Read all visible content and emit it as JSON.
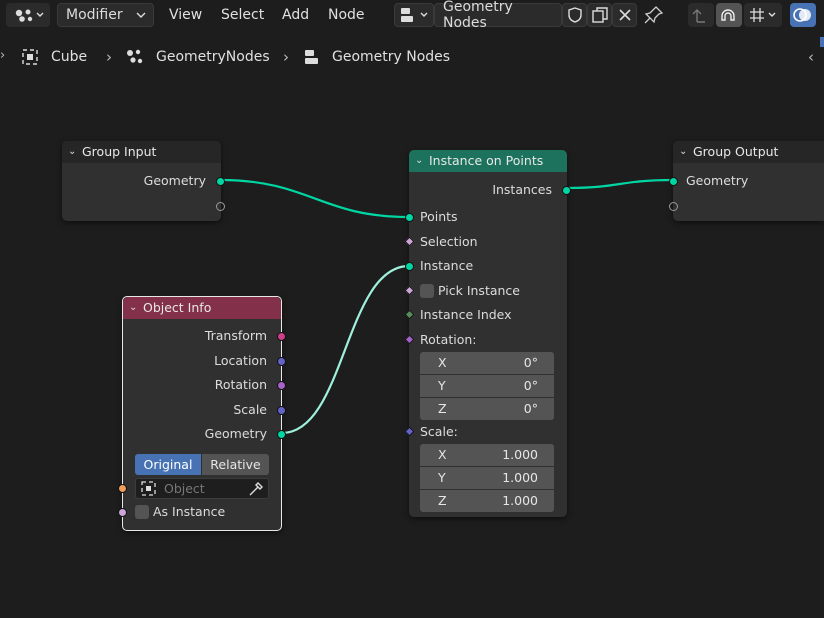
{
  "header": {
    "editor_type_icon": "node-editor-icon",
    "mode_label": "Modifier",
    "menus": [
      "View",
      "Select",
      "Add",
      "Node"
    ],
    "node_tree_name": "Geometry Nodes"
  },
  "breadcrumb": [
    "Cube",
    "GeometryNodes",
    "Geometry Nodes"
  ],
  "nodes": {
    "group_input": {
      "title": "Group Input",
      "outputs": [
        "Geometry"
      ]
    },
    "group_output": {
      "title": "Group Output",
      "inputs": [
        "Geometry"
      ]
    },
    "instance_on_points": {
      "title": "Instance on Points",
      "output": "Instances",
      "inputs": [
        "Points",
        "Selection",
        "Instance",
        "Pick Instance",
        "Instance Index"
      ],
      "rotation": {
        "label": "Rotation:",
        "x": "0°",
        "y": "0°",
        "z": "0°"
      },
      "scale": {
        "label": "Scale:",
        "x": "1.000",
        "y": "1.000",
        "z": "1.000"
      },
      "axis_labels": [
        "X",
        "Y",
        "Z"
      ]
    },
    "object_info": {
      "title": "Object Info",
      "outputs": [
        "Transform",
        "Location",
        "Rotation",
        "Scale",
        "Geometry"
      ],
      "mode_options": [
        "Original",
        "Relative"
      ],
      "mode_selected": "Original",
      "object_placeholder": "Object",
      "as_instance_label": "As Instance"
    }
  },
  "colors": {
    "geometry_socket": "#00d6a3",
    "instance_header": "#1d725e",
    "object_info_header": "#83314a",
    "accent_blue": "#4772b3"
  }
}
